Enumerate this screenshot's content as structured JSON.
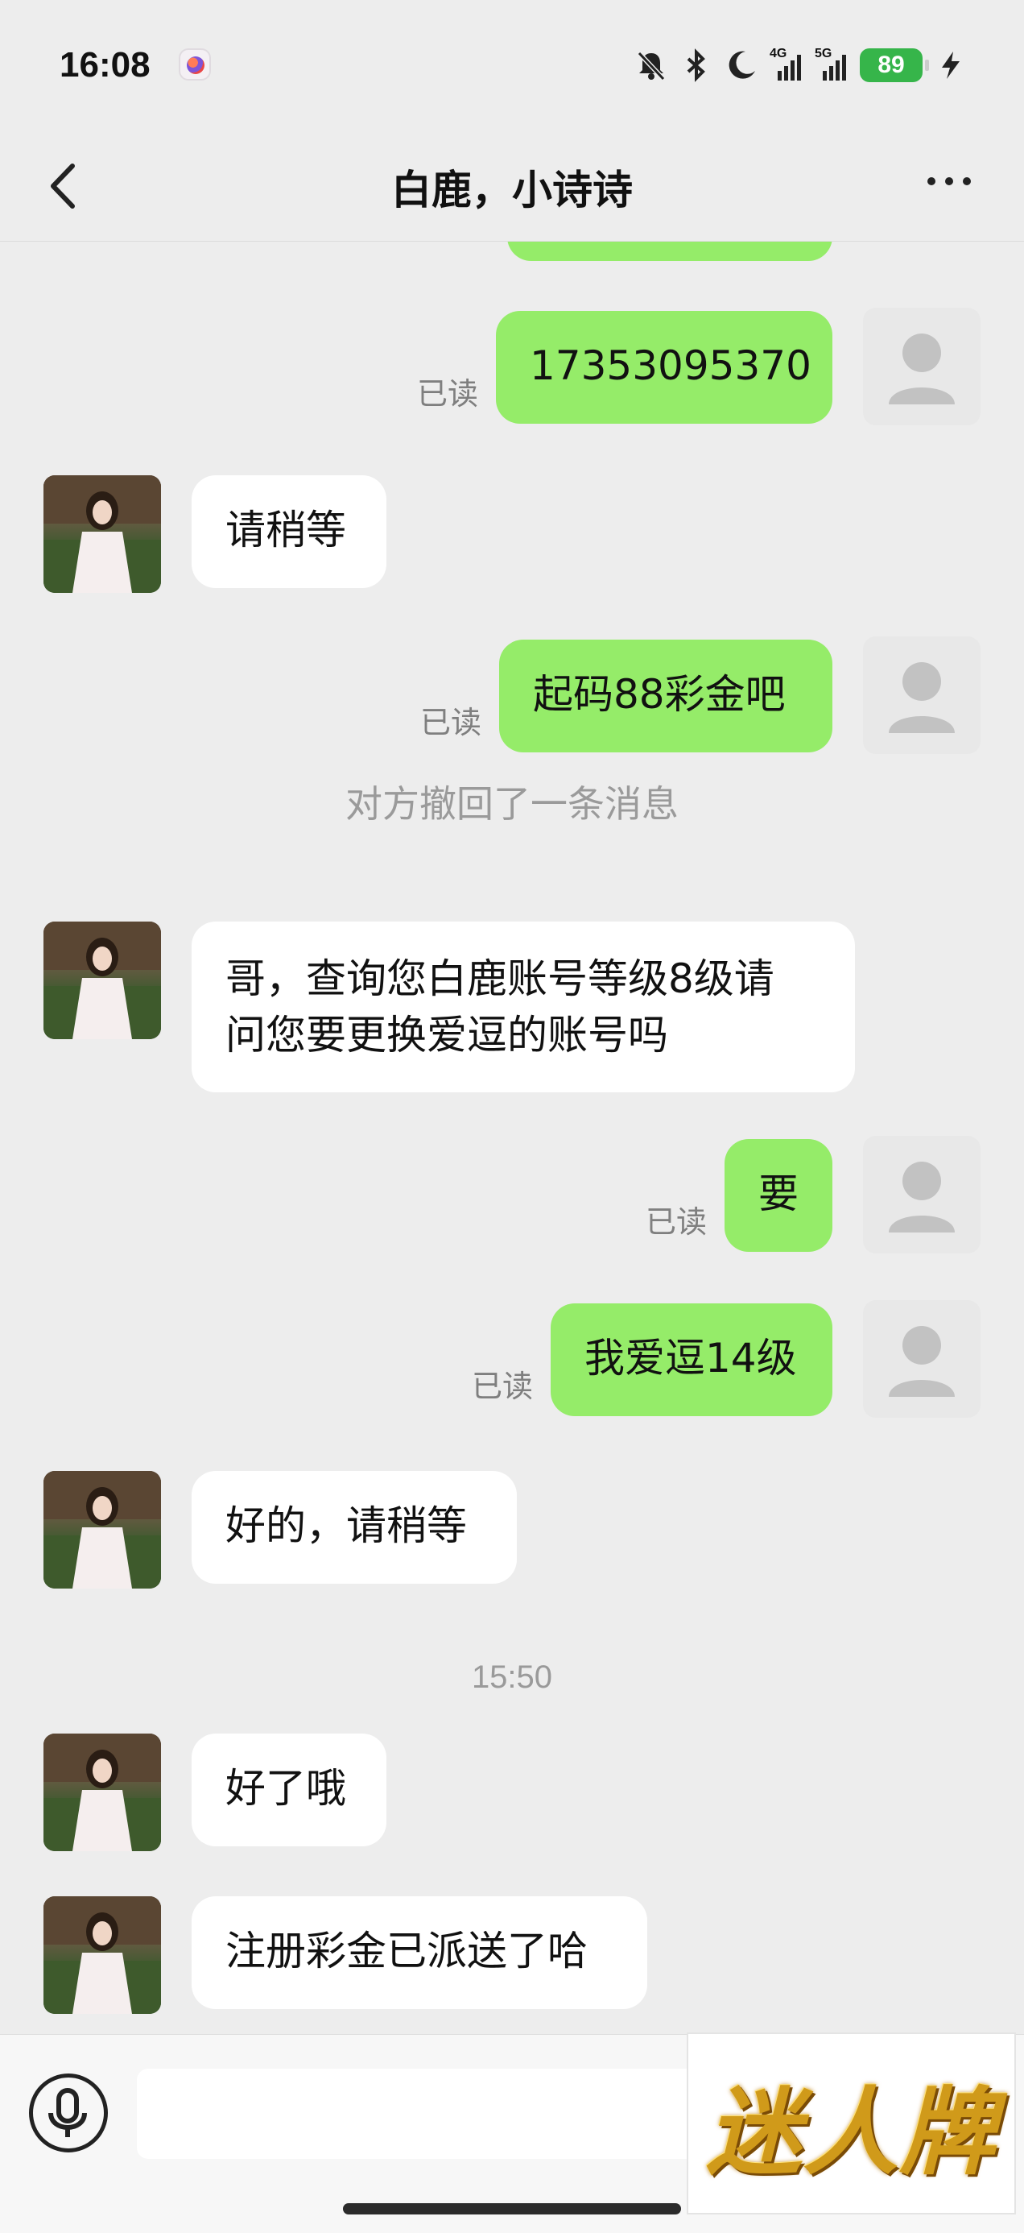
{
  "status": {
    "time": "16:08",
    "battery": "89",
    "net1": "4G",
    "net2": "5G"
  },
  "nav": {
    "title": "白鹿，小诗诗"
  },
  "messages": {
    "m1": {
      "text": "17353095370",
      "read": "已读"
    },
    "m2": {
      "text": "请稍等"
    },
    "m3": {
      "text": "起码88彩金吧",
      "read": "已读"
    },
    "m4": {
      "text": "对方撤回了一条消息"
    },
    "m5": {
      "line1": "哥，查询您白鹿账号等级8级请",
      "line2": "问您要更换爱逗的账号吗"
    },
    "m6": {
      "text": "要",
      "read": "已读"
    },
    "m7": {
      "text": "我爱逗14级",
      "read": "已读"
    },
    "m8": {
      "text": "好的，请稍等"
    },
    "m9": {
      "text": "15:50"
    },
    "m10": {
      "text": "好了哦"
    },
    "m11": {
      "text": "注册彩金已派送了哈"
    }
  },
  "sticker": {
    "text": "迷人牌"
  },
  "colors": {
    "my_bubble": "#95ec69",
    "their_bubble": "#ffffff",
    "background": "#ededed",
    "battery": "#36b54a"
  }
}
